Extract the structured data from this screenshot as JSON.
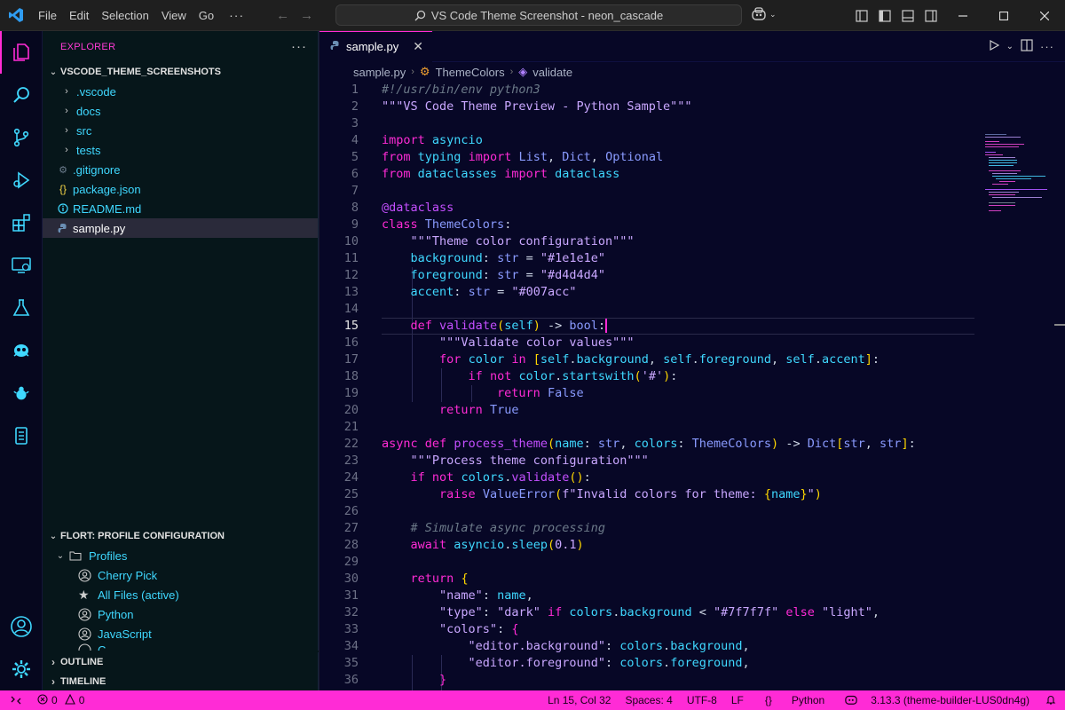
{
  "titlebar": {
    "menu": [
      "File",
      "Edit",
      "Selection",
      "View",
      "Go"
    ],
    "more": "···",
    "search_text": "VS Code Theme Screenshot - neon_cascade"
  },
  "sidebar": {
    "title": "EXPLORER",
    "project": "VSCODE_THEME_SCREENSHOTS",
    "tree": [
      {
        "label": ".vscode",
        "type": "folder"
      },
      {
        "label": "docs",
        "type": "folder"
      },
      {
        "label": "src",
        "type": "folder"
      },
      {
        "label": "tests",
        "type": "folder"
      },
      {
        "label": ".gitignore",
        "type": "file",
        "icon": "gear-icon"
      },
      {
        "label": "package.json",
        "type": "file",
        "icon": "braces-icon"
      },
      {
        "label": "README.md",
        "type": "file",
        "icon": "info-icon"
      },
      {
        "label": "sample.py",
        "type": "file",
        "icon": "python-icon",
        "selected": true
      }
    ],
    "flort_title": "FLORT: PROFILE CONFIGURATION",
    "profiles_label": "Profiles",
    "profiles": [
      {
        "label": "Cherry Pick",
        "icon": "account-icon"
      },
      {
        "label": "All Files (active)",
        "icon": "star-icon"
      },
      {
        "label": "Python",
        "icon": "account-icon"
      },
      {
        "label": "JavaScript",
        "icon": "account-icon"
      },
      {
        "label": "C",
        "icon": "account-icon"
      }
    ],
    "outline": "OUTLINE",
    "timeline": "TIMELINE"
  },
  "editor": {
    "tab_label": "sample.py",
    "breadcrumb": [
      "sample.py",
      "ThemeColors",
      "validate"
    ],
    "current_line": 15
  },
  "statusbar": {
    "errors": "0",
    "warnings": "0",
    "position": "Ln 15, Col 32",
    "spaces": "Spaces: 4",
    "encoding": "UTF-8",
    "eol": "LF",
    "language": "Python",
    "interpreter": "3.13.3 (theme-builder-LUS0dn4g)"
  },
  "colors": {
    "accent": "#ff2bd6",
    "editor_bg": "#070726",
    "sidebar_bg": "#06161a",
    "cyan": "#3fd8ff"
  }
}
